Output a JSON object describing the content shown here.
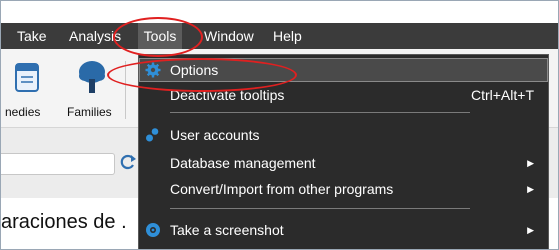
{
  "menubar": {
    "items": [
      {
        "label": "Take"
      },
      {
        "label": "Analysis"
      },
      {
        "label": "Tools"
      },
      {
        "label": "Window"
      },
      {
        "label": "Help"
      }
    ]
  },
  "toolbar": {
    "items": [
      {
        "label": "nedies",
        "icon": "document-icon"
      },
      {
        "label": "Families",
        "icon": "tree-icon"
      }
    ]
  },
  "content": {
    "text": "araciones de ."
  },
  "tools_menu": {
    "items": [
      {
        "label": "Options",
        "icon": "gear-icon",
        "highlighted": true
      },
      {
        "label": "Deactivate tooltips",
        "shortcut": "Ctrl+Alt+T"
      },
      {
        "label": "User accounts",
        "icon": "users-icon"
      },
      {
        "label": "Database management",
        "submenu": true
      },
      {
        "label": "Convert/Import from other programs",
        "submenu": true
      },
      {
        "label": "Take a screenshot",
        "icon": "camera-icon",
        "submenu": true
      }
    ]
  },
  "colors": {
    "menubar_bg": "#3b3b3b",
    "menu_bg": "#2b2b2b",
    "annotation": "#e02020",
    "icon_blue": "#2f8fd8"
  }
}
